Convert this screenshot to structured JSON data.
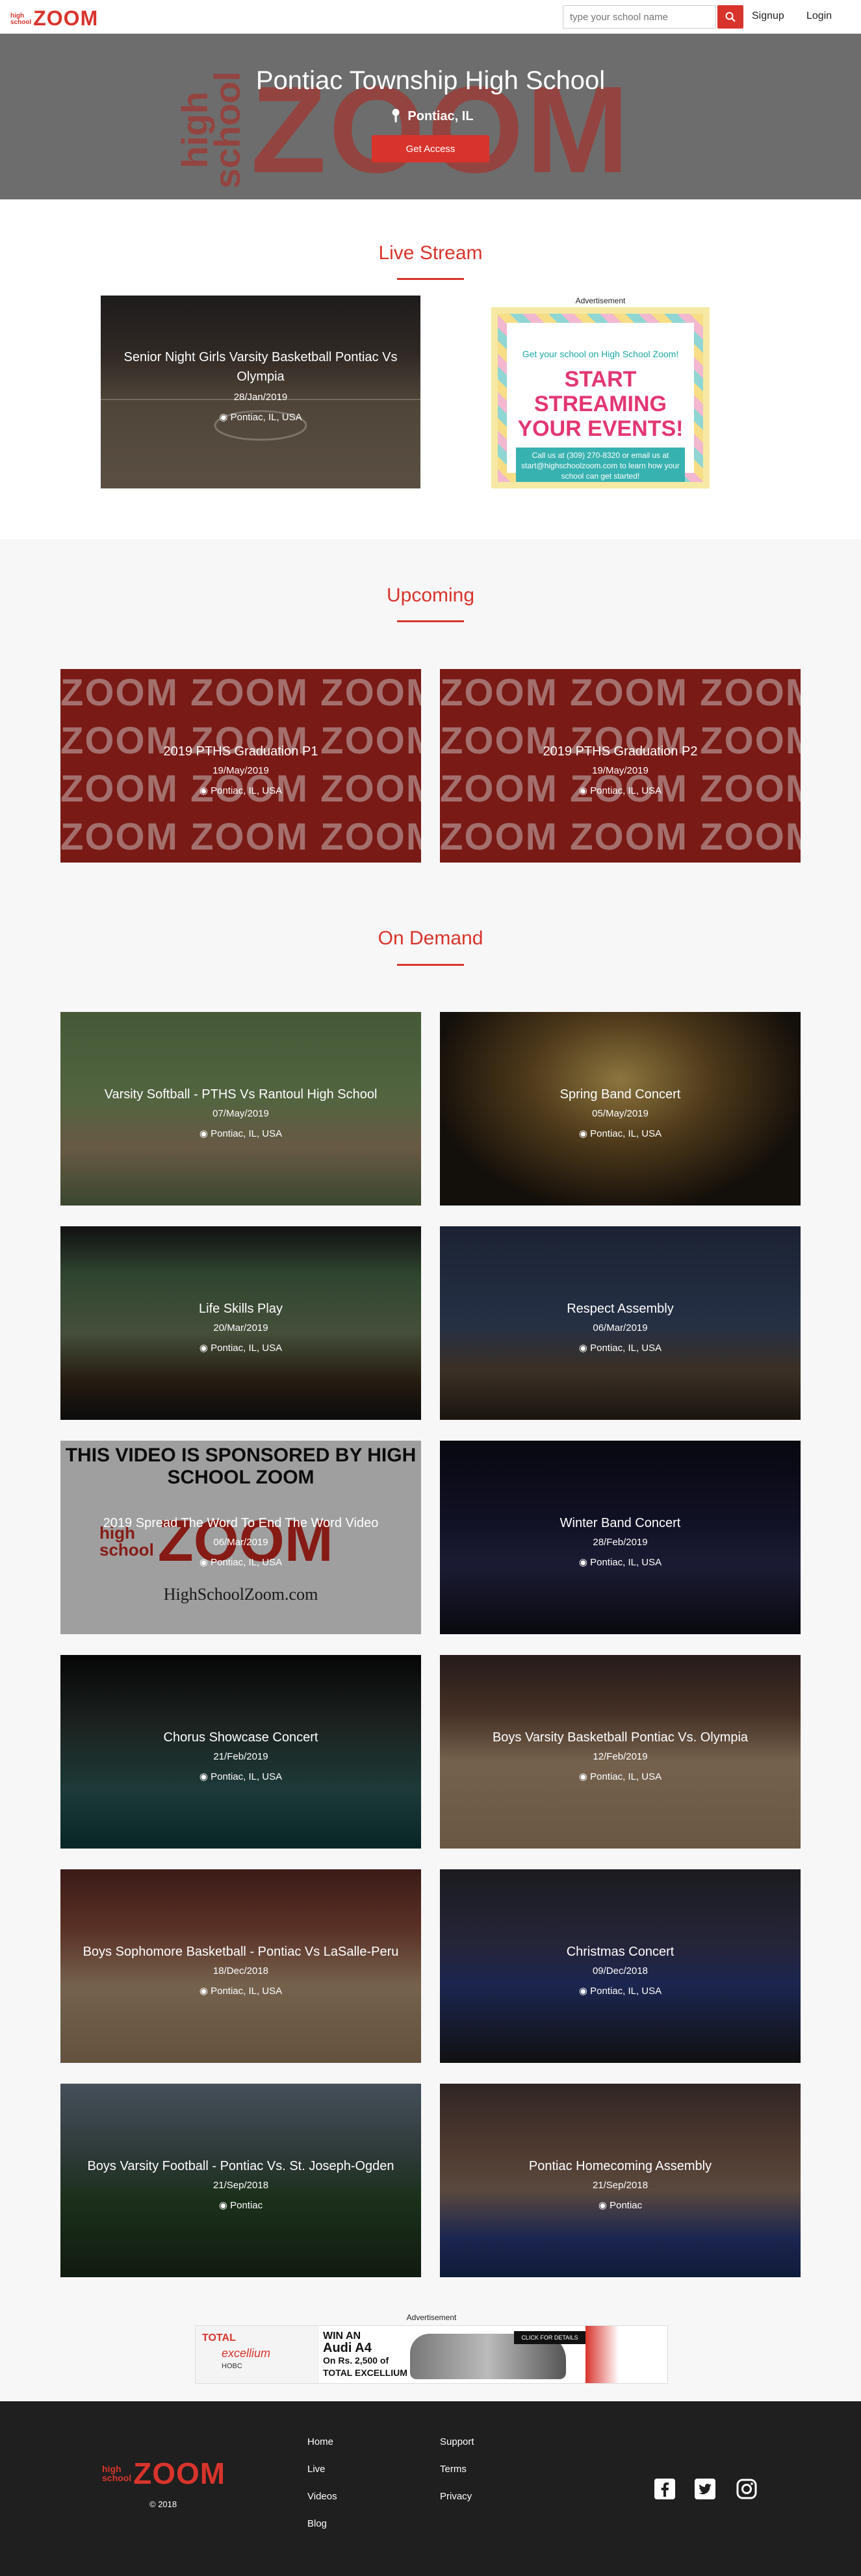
{
  "brand": {
    "high": "high",
    "school": "school",
    "zoom": "ZOOM",
    "color": "#d8342c"
  },
  "nav": {
    "search_placeholder": "type your school name",
    "signup": "Signup",
    "login": "Login"
  },
  "hero": {
    "school_name": "Pontiac Township High School",
    "location": "Pontiac, IL",
    "cta": "Get Access"
  },
  "live": {
    "heading": "Live Stream",
    "card": {
      "title": "Senior Night Girls Varsity Basketball Pontiac Vs Olympia",
      "date": "28/Jan/2019",
      "location": "Pontiac, IL, USA"
    },
    "ad_label": "Advertisement",
    "ad": {
      "line1": "Get your school on High School Zoom!",
      "line2": "START STREAMING YOUR EVENTS!",
      "line3": "Call us at (309) 270-8320 or email us at start@highschoolzoom.com to learn how your school can get started!"
    }
  },
  "upcoming": {
    "heading": "Upcoming",
    "items": [
      {
        "title": "2019 PTHS Graduation P1",
        "date": "19/May/2019",
        "location": "Pontiac, IL, USA"
      },
      {
        "title": "2019 PTHS Graduation P2",
        "date": "19/May/2019",
        "location": "Pontiac, IL, USA"
      }
    ]
  },
  "on_demand": {
    "heading": "On Demand",
    "items": [
      {
        "title": "Varsity Softball - PTHS Vs Rantoul High School",
        "date": "07/May/2019",
        "location": "Pontiac, IL, USA"
      },
      {
        "title": "Spring Band Concert",
        "date": "05/May/2019",
        "location": "Pontiac, IL, USA"
      },
      {
        "title": "Life Skills Play",
        "date": "20/Mar/2019",
        "location": "Pontiac, IL, USA"
      },
      {
        "title": "Respect Assembly",
        "date": "06/Mar/2019",
        "location": "Pontiac, IL, USA"
      },
      {
        "title": "2019 Spread The Word To End The Word Video",
        "date": "06/Mar/2019",
        "location": "Pontiac, IL, USA",
        "overlay_top": "THIS VIDEO IS SPONSORED BY HIGH SCHOOL ZOOM",
        "overlay_url": "HighSchoolZoom.com"
      },
      {
        "title": "Winter Band Concert",
        "date": "28/Feb/2019",
        "location": "Pontiac, IL, USA"
      },
      {
        "title": "Chorus Showcase Concert",
        "date": "21/Feb/2019",
        "location": "Pontiac, IL, USA"
      },
      {
        "title": "Boys Varsity Basketball Pontiac Vs. Olympia",
        "date": "12/Feb/2019",
        "location": "Pontiac, IL, USA"
      },
      {
        "title": "Boys Sophomore Basketball - Pontiac Vs LaSalle-Peru",
        "date": "18/Dec/2018",
        "location": "Pontiac, IL, USA"
      },
      {
        "title": "Christmas Concert",
        "date": "09/Dec/2018",
        "location": "Pontiac, IL, USA"
      },
      {
        "title": "Boys Varsity Football - Pontiac Vs. St. Joseph-Ogden",
        "date": "21/Sep/2018",
        "location": "Pontiac"
      },
      {
        "title": "Pontiac Homecoming Assembly",
        "date": "21/Sep/2018",
        "location": "Pontiac"
      }
    ]
  },
  "bottom_ad": {
    "label": "Advertisement",
    "brand": "TOTAL",
    "brand2": "excellium",
    "brand3": "HOBC",
    "line1": "WIN AN",
    "line2": "Audi A4",
    "line3": "On Rs. 2,500 of",
    "line4": "TOTAL EXCELLIUM",
    "cta": "CLICK FOR DETAILS"
  },
  "footer": {
    "copyright": "© 2018",
    "col1": [
      "Home",
      "Live",
      "Videos",
      "Blog"
    ],
    "col2": [
      "Support",
      "Terms",
      "Privacy"
    ],
    "social": [
      "facebook-icon",
      "twitter-icon",
      "instagram-icon"
    ]
  }
}
